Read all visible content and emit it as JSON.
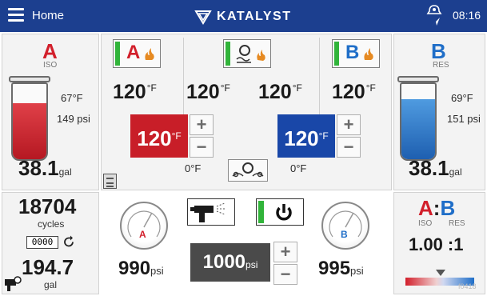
{
  "header": {
    "home_label": "Home",
    "brand": "KATALYST",
    "time": "08:16"
  },
  "side_a": {
    "letter": "A",
    "sub": "ISO",
    "temp": "67°F",
    "pressure": "149 psi",
    "volume": "38.1",
    "volume_unit": "gal",
    "color": "#d21f2b"
  },
  "side_b": {
    "letter": "B",
    "sub": "RES",
    "temp": "69°F",
    "pressure": "151 psi",
    "volume": "38.1",
    "volume_unit": "gal",
    "color": "#1f6ec8"
  },
  "heaters": {
    "a_heater": {
      "label": "A",
      "actual": "120",
      "unit": "°F"
    },
    "hose": {
      "actual_left": "120",
      "actual_right": "120",
      "unit": "°F"
    },
    "b_heater": {
      "label": "B",
      "actual": "120",
      "unit": "°F"
    },
    "a_setpoint": {
      "value": "120",
      "unit": "°F",
      "offset": "0°F"
    },
    "b_setpoint": {
      "value": "120",
      "unit": "°F",
      "offset": "0°F"
    },
    "plus": "+",
    "minus": "−"
  },
  "counter": {
    "cycles": "18704",
    "cycles_label": "cycles",
    "reset_counter": "0000",
    "total": "194.7",
    "total_unit": "gal"
  },
  "pumps": {
    "a_label": "A",
    "b_label": "B",
    "a_pressure": "990",
    "b_pressure": "995",
    "unit": "psi",
    "target": "1000",
    "target_unit": "psi",
    "plus": "+",
    "minus": "−"
  },
  "ratio": {
    "a_label": "A",
    "b_label": "B",
    "colon": ":",
    "a_sub": "ISO",
    "b_sub": "RES",
    "value": "1.00 :1",
    "corner_code": "f0418"
  },
  "colors": {
    "header": "#1c3f8f",
    "a_red": "#d21f2b",
    "b_blue": "#1f6ec8",
    "setpoint_red": "#c81e28",
    "setpoint_blue": "#1947a8",
    "on_green": "#31b43a",
    "pressure_dark": "#4a4a4a"
  },
  "icons": [
    "menu-icon",
    "katalyst-logo-icon",
    "status-icon",
    "hose-heat-icon",
    "heater-icon",
    "reset-icon",
    "spray-gun-icon",
    "power-icon",
    "gauge-icon",
    "clipboard-icon",
    "camera-icon"
  ]
}
